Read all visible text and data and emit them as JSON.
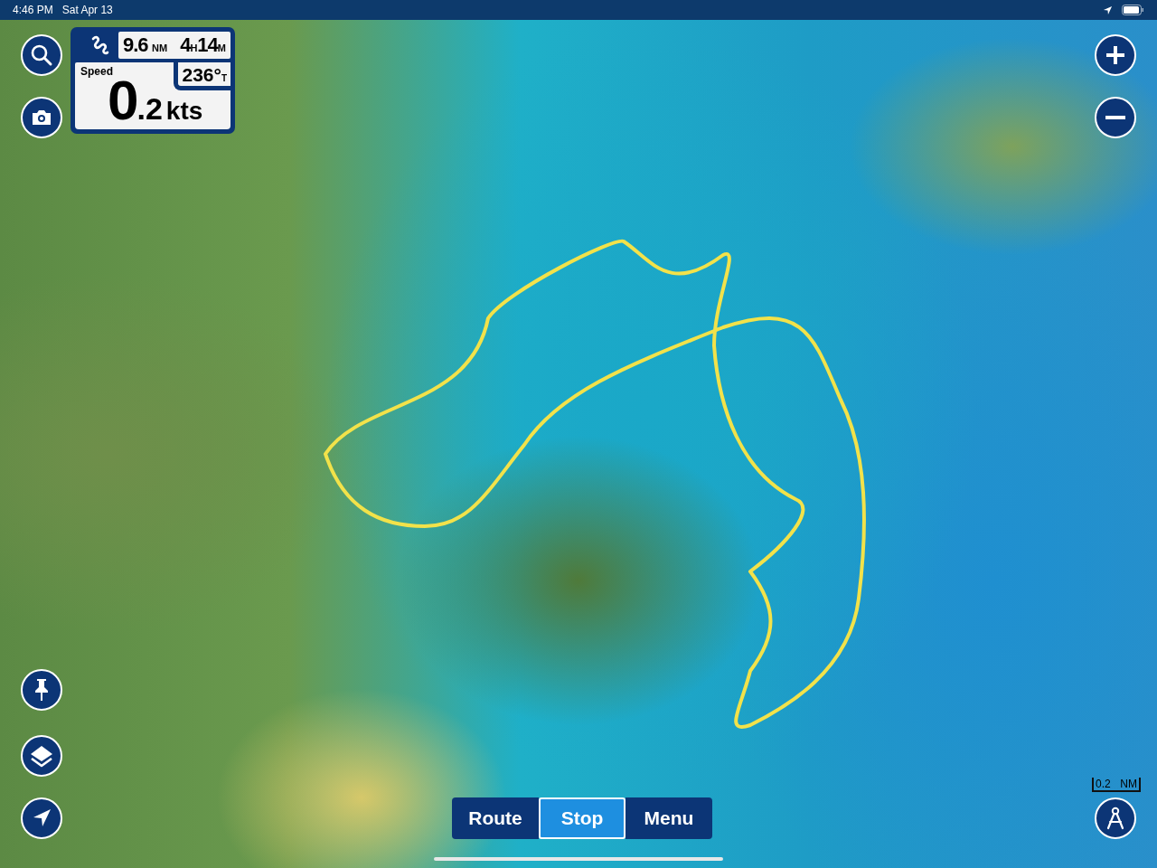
{
  "status_bar": {
    "time": "4:46 PM",
    "date": "Sat Apr 13"
  },
  "trip_panel": {
    "distance": {
      "value": "9.6",
      "unit": "NM"
    },
    "duration": [
      {
        "value": "4",
        "unit": "H"
      },
      {
        "value": "14",
        "unit": "M"
      }
    ],
    "heading": {
      "value": "236°",
      "unit": "T"
    },
    "speed_label": "Speed",
    "speed": {
      "whole": "0",
      "fraction": ".2",
      "unit": "kts"
    }
  },
  "bottom_bar": {
    "buttons": [
      {
        "label": "Route",
        "selected": false
      },
      {
        "label": "Stop",
        "selected": true
      },
      {
        "label": "Menu",
        "selected": false
      }
    ]
  },
  "scale": {
    "value": "0.2",
    "unit": "NM"
  }
}
